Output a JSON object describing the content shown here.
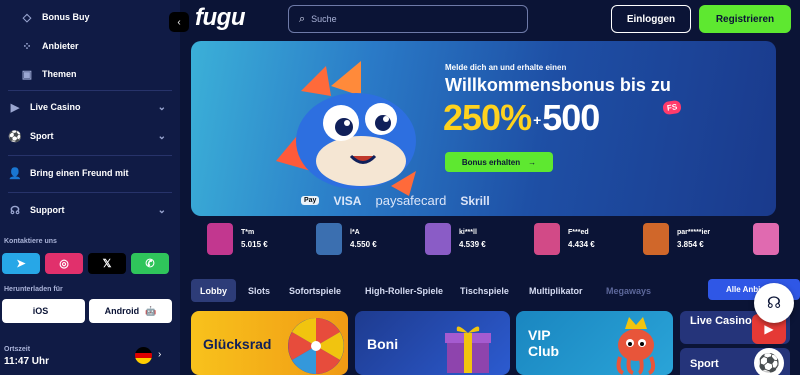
{
  "sidebar": {
    "items": [
      {
        "label": "Bonus Buy",
        "icon": "bonus-buy-icon"
      },
      {
        "label": "Anbieter",
        "icon": "providers-icon"
      },
      {
        "label": "Themen",
        "icon": "themes-icon"
      },
      {
        "label": "Live Casino",
        "icon": "live-casino-icon"
      },
      {
        "label": "Sport",
        "icon": "sport-icon"
      },
      {
        "label": "Bring einen Freund mit",
        "icon": "add-friend-icon"
      },
      {
        "label": "Support",
        "icon": "headset-icon"
      }
    ],
    "contact_label": "Kontaktiere uns",
    "socials": [
      {
        "name": "telegram",
        "color": "#27a7e7"
      },
      {
        "name": "instagram",
        "color": "#e1306c"
      },
      {
        "name": "x",
        "color": "#000000"
      },
      {
        "name": "whatsapp",
        "color": "#2fc55b"
      }
    ],
    "download_label": "Herunterladen für",
    "ios_label": "iOS",
    "android_label": "Android",
    "timezone_label": "Ortszeit",
    "time": "11:47 Uhr"
  },
  "header": {
    "logo_text": "fugu",
    "search_placeholder": "Suche",
    "login_label": "Einloggen",
    "register_label": "Registrieren"
  },
  "banner": {
    "subtitle": "Melde dich an und erhalte einen",
    "title": "Willkommensbonus bis zu",
    "percent": "250%",
    "plus": "+",
    "spins": "500",
    "fs_badge": "FS",
    "button_label": "Bonus erhalten",
    "payment_methods": [
      "Pay",
      "VISA",
      "paysafecard",
      "Skrill"
    ]
  },
  "winners": [
    {
      "name": "T*m",
      "amount": "5.015 €",
      "color": "#c2378f"
    },
    {
      "name": "l*A",
      "amount": "4.550 €",
      "color": "#3b6fb0"
    },
    {
      "name": "ki***ll",
      "amount": "4.539 €",
      "color": "#8a5cc6"
    },
    {
      "name": "F***ed",
      "amount": "4.434 €",
      "color": "#d24a87"
    },
    {
      "name": "par*****ier",
      "amount": "3.854 €",
      "color": "#d0672a"
    }
  ],
  "tabs": [
    {
      "label": "Lobby",
      "active": true
    },
    {
      "label": "Slots"
    },
    {
      "label": "Sofortspiele"
    },
    {
      "label": "High-Roller-Spiele"
    },
    {
      "label": "Tischspiele"
    },
    {
      "label": "Multiplikator"
    },
    {
      "label": "Megaways"
    }
  ],
  "all_providers_label": "Alle Anbieter",
  "categories": [
    {
      "label": "Glücksrad",
      "color": "#f4b41a"
    },
    {
      "label": "Boni",
      "color": "#2c4fae"
    },
    {
      "label": "VIP Club",
      "color": "#1d8bbd"
    },
    {
      "label": "Live Casino",
      "color": "#25347a"
    },
    {
      "label": "Sport",
      "color": "#25347a"
    }
  ]
}
